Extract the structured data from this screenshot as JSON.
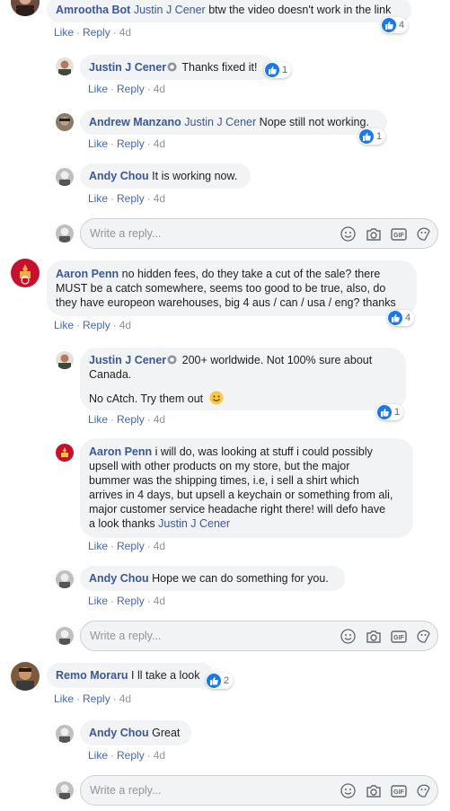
{
  "thread": {
    "c1": {
      "name": "Amrootha Bot",
      "tag": "Justin J Cener",
      "text": " btw the video doesn't work in the link",
      "likes": "4"
    },
    "c1r1": {
      "name": "Justin J Cener",
      "text": "Thanks fixed it!",
      "likes": "1"
    },
    "c1r2": {
      "name": "Andrew Manzano",
      "tag": "Justin J Cener",
      "text": " Nope still not working.",
      "likes": "1"
    },
    "c1r3": {
      "name": "Andy Chou",
      "text": " It is working now."
    },
    "c2": {
      "name": "Aaron Penn",
      "text_lines": [
        " no hidden fees, do they take a cut of the sale? there",
        "MUST be a catch somewhere, seems too good to be true, also, do",
        "they have europeon warehouses, big 4 aus / can / usa / eng? thanks"
      ],
      "likes": "4"
    },
    "c2r1": {
      "name": "Justin J Cener",
      "line1": "200+ worldwide. Not 100% sure about",
      "line2": "Canada.",
      "line3": "No cAtch. Try them out",
      "likes": "1"
    },
    "c2r2": {
      "name": "Aaron Penn",
      "lines": [
        " i will do, was looking at stuff i could possibly",
        "upsell with other products on my store, but the major",
        "bummer was the shipping times, i.e, i sell a shirt which",
        "arrives in 4 days, but upsell a keychain or something from ali,",
        "major customer service headache right there! will defo have",
        "a look thanks "
      ],
      "tag": "Justin J Cener"
    },
    "c2r3": {
      "name": "Andy Chou",
      "text": " Hope we can do something for you."
    },
    "c3": {
      "name": "Remo Moraru",
      "text": " I ll take a look",
      "likes": "2"
    },
    "c3r1": {
      "name": "Andy Chou",
      "text": " Great"
    }
  },
  "actions": {
    "like": "Like",
    "reply": "Reply",
    "dot": "·",
    "time": "4d"
  },
  "composer": {
    "placeholder": "Write a reply...",
    "icons": [
      "emoji-icon",
      "camera-icon",
      "gif-icon",
      "sticker-icon"
    ],
    "gif_label": "GIF"
  },
  "colors": {
    "link": "#385898",
    "action": "#4267b2",
    "meta": "#90949c",
    "bubble": "#f2f3f5",
    "like": "#1877f2"
  }
}
